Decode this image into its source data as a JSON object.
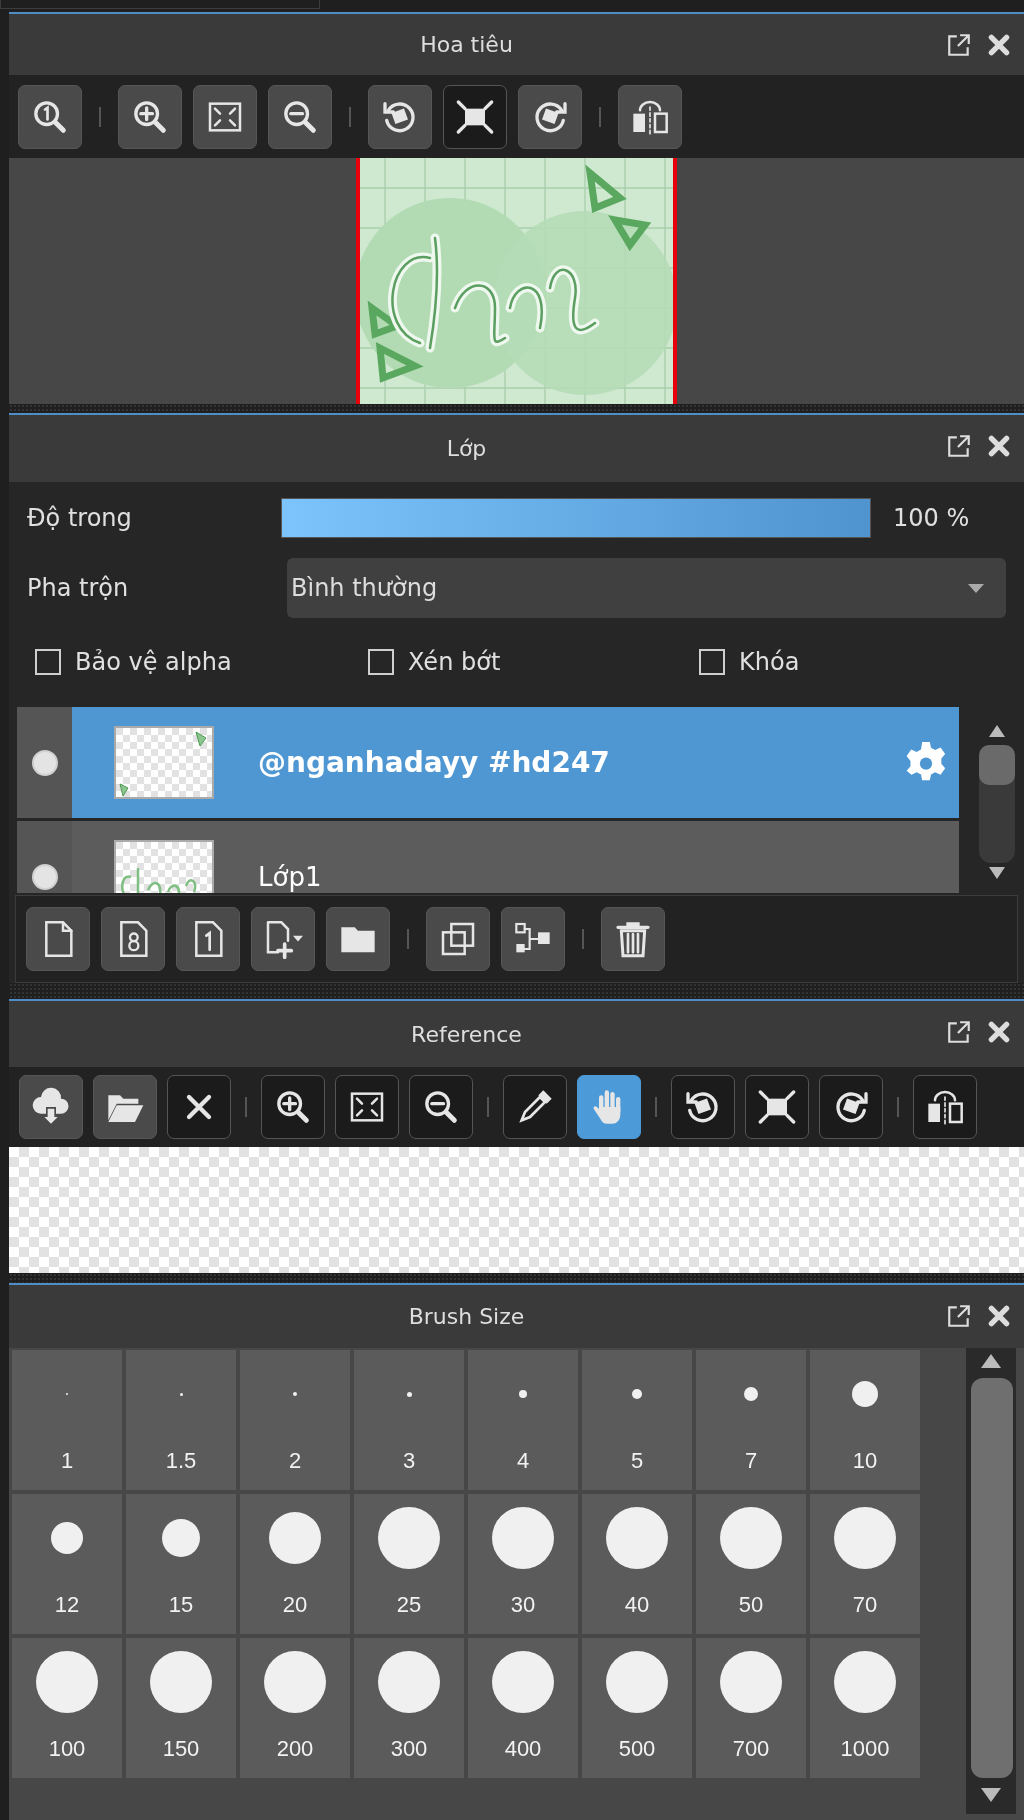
{
  "navigator": {
    "title": "Hoa tiêu",
    "toolbar": [
      [
        {
          "kind": "zoom-actual",
          "raised": true
        }
      ],
      [
        {
          "kind": "zoom-in",
          "raised": true
        },
        {
          "kind": "fit",
          "raised": true
        },
        {
          "kind": "zoom-out",
          "raised": true
        }
      ],
      [
        {
          "kind": "rotate-left",
          "raised": true
        },
        {
          "kind": "fullscreen",
          "raised": false
        },
        {
          "kind": "rotate-right",
          "raised": true
        }
      ],
      [
        {
          "kind": "flip",
          "raised": true
        }
      ]
    ]
  },
  "layers_panel": {
    "title": "Lớp",
    "opacity": {
      "label": "Độ trong",
      "level": 1,
      "reading": "100 %"
    },
    "blend": {
      "label": "Pha trộn",
      "value": "Bình thường"
    },
    "options": [
      {
        "label": "Bảo vệ alpha",
        "checked": false
      },
      {
        "label": "Xén bớt",
        "checked": false
      },
      {
        "label": "Khóa",
        "checked": false
      }
    ],
    "layers": [
      {
        "name": "@nganhadayy #hd247",
        "selected": true,
        "visible": true
      },
      {
        "name": "Lớp1",
        "selected": false,
        "visible": true
      }
    ],
    "toolbar": [
      [
        {
          "kind": "new-layer",
          "raised": true
        },
        {
          "kind": "new-8bit",
          "raised": true
        },
        {
          "kind": "new-1bit",
          "raised": true
        },
        {
          "kind": "add-menu",
          "raised": true
        },
        {
          "kind": "folder",
          "raised": true
        }
      ],
      [
        {
          "kind": "duplicate",
          "raised": true
        },
        {
          "kind": "merge",
          "raised": true
        }
      ],
      [
        {
          "kind": "delete",
          "raised": true
        }
      ]
    ]
  },
  "reference": {
    "title": "Reference",
    "toolbar": [
      [
        {
          "kind": "import",
          "raised": true,
          "selected": false
        },
        {
          "kind": "open",
          "raised": true,
          "selected": false
        },
        {
          "kind": "close",
          "raised": false,
          "selected": false
        }
      ],
      [
        {
          "kind": "zoom-in",
          "raised": false,
          "selected": false
        },
        {
          "kind": "fit",
          "raised": false,
          "selected": false
        },
        {
          "kind": "zoom-out",
          "raised": false,
          "selected": false
        }
      ],
      [
        {
          "kind": "eyedropper",
          "raised": false,
          "selected": false
        },
        {
          "kind": "hand",
          "raised": false,
          "selected": true
        }
      ],
      [
        {
          "kind": "rotate-left",
          "raised": false,
          "selected": false
        },
        {
          "kind": "fullscreen",
          "raised": false,
          "selected": false
        },
        {
          "kind": "rotate-right",
          "raised": false,
          "selected": false
        }
      ],
      [
        {
          "kind": "flip",
          "raised": false,
          "selected": false
        }
      ]
    ]
  },
  "brush_size": {
    "title": "Brush Size",
    "sizes": [
      "1",
      "1.5",
      "2",
      "3",
      "4",
      "5",
      "7",
      "10",
      "12",
      "15",
      "20",
      "25",
      "30",
      "40",
      "50",
      "70",
      "100",
      "150",
      "200",
      "300",
      "400",
      "500",
      "700",
      "1000"
    ]
  }
}
